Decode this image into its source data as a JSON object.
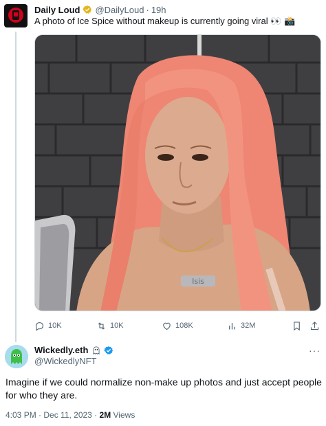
{
  "parent_tweet": {
    "author_name": "Daily Loud",
    "handle": "@DailyLoud",
    "separator": "·",
    "time": "19h",
    "text": "A photo of Ice Spice without makeup is currently going viral 👀 📸",
    "photo_necklace_text": "Isis",
    "stats": {
      "replies": "10K",
      "reposts": "10K",
      "likes": "108K",
      "views": "32M"
    }
  },
  "reply_tweet": {
    "author_name": "Wickedly.eth",
    "handle": "@WickedlyNFT",
    "more_label": "···",
    "text": "Imagine if we could normalize non-make up photos and just accept people for who they are.",
    "timestamp": "4:03 PM · Dec 11, 2023 · ",
    "views_count": "2M",
    "views_label": " Views"
  },
  "colors": {
    "verified_blue": "#1d9bf0",
    "verified_gold": "#e2b719",
    "muted_text": "#536471",
    "hair": "#f08a78"
  }
}
